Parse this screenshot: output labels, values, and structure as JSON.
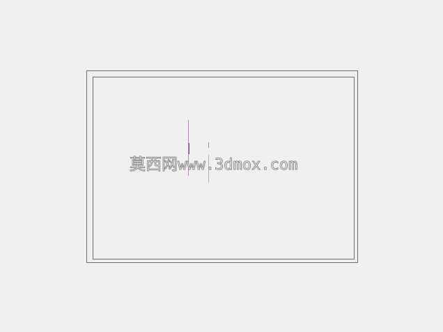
{
  "watermark": {
    "cjk": "莫西网",
    "latin": "www.3dmox.com"
  },
  "colors": {
    "background": "#f0f0f0",
    "frame": "#6e6e6e",
    "accent_line": "#c879c8"
  }
}
